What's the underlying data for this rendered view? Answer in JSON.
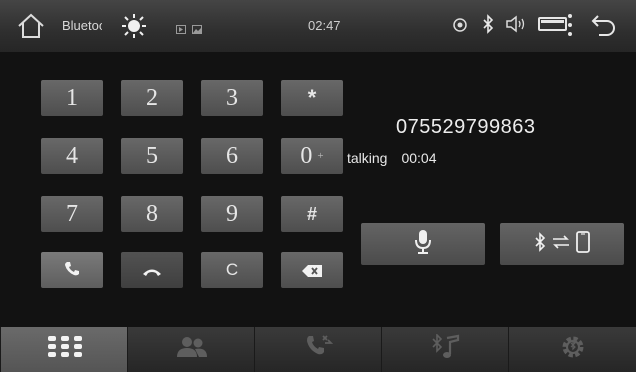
{
  "status_bar": {
    "app_title": "Bluetooth",
    "time": "02:47",
    "icons": [
      "home-icon",
      "brightness-icon",
      "media-icon",
      "gallery-icon",
      "gps-icon",
      "bluetooth-icon",
      "volume-icon",
      "battery-icon",
      "more-icon",
      "back-icon"
    ]
  },
  "keypad": {
    "keys": [
      "1",
      "2",
      "3",
      "*",
      "4",
      "5",
      "6",
      "0",
      "7",
      "8",
      "9",
      "#"
    ],
    "zero_sub": "+",
    "clear_label": "C"
  },
  "call": {
    "number": "075529799863",
    "state": "talking",
    "duration": "00:04"
  },
  "actions": {
    "mic_icon": "microphone-icon",
    "transfer_icon": "bluetooth-phone-transfer-icon"
  },
  "tabs": [
    {
      "name": "dialpad",
      "icon": "dialpad-icon",
      "active": true
    },
    {
      "name": "contacts",
      "icon": "contacts-icon",
      "active": false
    },
    {
      "name": "call-log",
      "icon": "call-log-icon",
      "active": false
    },
    {
      "name": "music",
      "icon": "music-icon",
      "active": false
    },
    {
      "name": "settings",
      "icon": "settings-icon",
      "active": false
    }
  ],
  "colors": {
    "background": "#121212",
    "key": "#5a5a5a",
    "active_tab": "#606060"
  }
}
